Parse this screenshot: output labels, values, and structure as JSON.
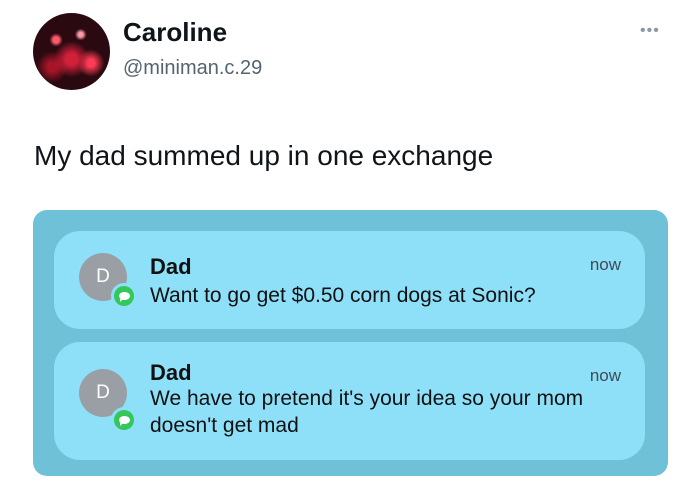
{
  "user": {
    "name": "Caroline",
    "handle": "@miniman.c.29"
  },
  "more_label": "•••",
  "tweet": {
    "text": "My dad summed up in one exchange"
  },
  "notifications": [
    {
      "initial": "D",
      "sender": "Dad",
      "time": "now",
      "message": "Want to go get $0.50 corn dogs at Sonic?"
    },
    {
      "initial": "D",
      "sender": "Dad",
      "time": "now",
      "message": "We have to pretend it's your idea so your mom doesn't get mad"
    }
  ],
  "colors": {
    "panel_bg": "#6fc1d8",
    "notification_bg": "#8ee0f9",
    "messages_green": "#35c759",
    "contact_gray": "#9a9fa6"
  }
}
